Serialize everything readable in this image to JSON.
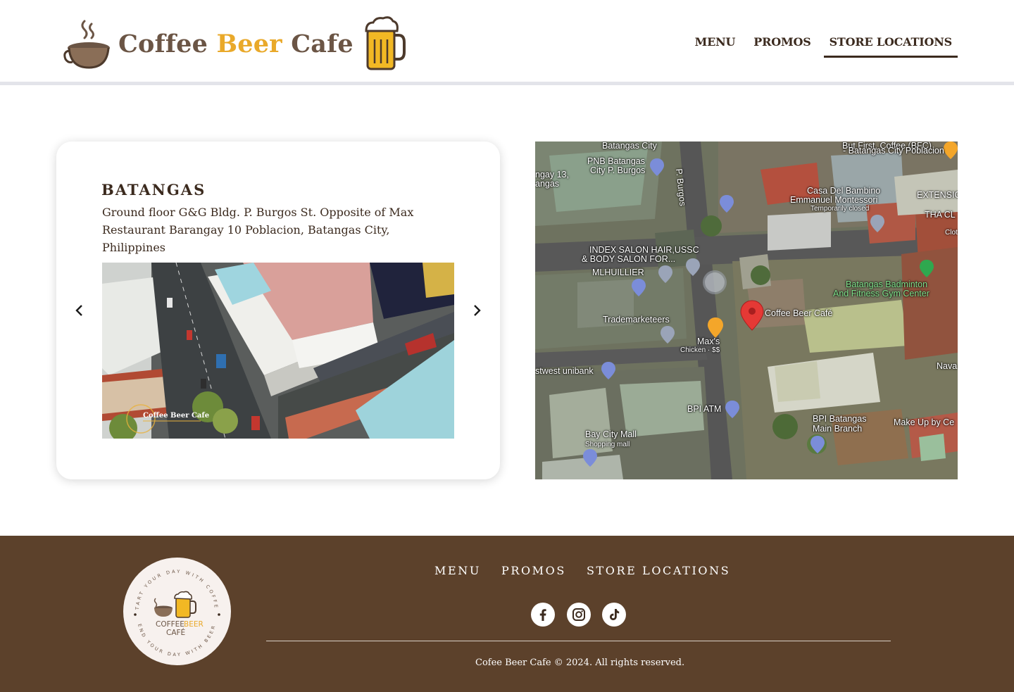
{
  "header": {
    "logo": {
      "word1": "Coffee",
      "word2": "Beer",
      "word3": "Cafe"
    },
    "nav": [
      {
        "label": "MENU",
        "active": false
      },
      {
        "label": "PROMOS",
        "active": false
      },
      {
        "label": "STORE LOCATIONS",
        "active": true
      }
    ]
  },
  "store": {
    "title": "BATANGAS",
    "address": "Ground floor G&G Bldg. P. Burgos St. Opposite of Max Restaurant Barangay 10 Poblacion, Batangas City, Philippines",
    "photo_watermark": "Coffee Beer Cafe",
    "prev_icon": "chevron-left-icon",
    "next_icon": "chevron-right-icon"
  },
  "map": {
    "labels": {
      "batangas_city": "Batangas City",
      "but_first": "But First, Coffee (BFC)",
      "but_first_2": "- Batangas City Poblacion",
      "pnb1": "PNB Batangas",
      "pnb2": "City P. Burgos",
      "burgos": "P. Burgos",
      "brgy13a": "ngay 13,",
      "brgy13b": "angas",
      "casa1": "Casa Del Bambino",
      "casa2": "Emmanuel Montessori",
      "casa3": "Temporarily closed",
      "extension": "EXTENSIC",
      "thai": "THA CL",
      "clot": "Clot",
      "index1": "INDEX SALON HAIR,USSC",
      "index2": "& BODY SALON FOR...",
      "mlhuillier": "MLHUILLIER",
      "badminton1": "Batangas Badminton",
      "badminton2": "And Fitness Gym Center",
      "coffee_beer": "Coffee Beer Café",
      "trademarketeers": "Trademarketeers",
      "maxs1": "Max's",
      "maxs2": "Chicken · $$",
      "eastwest": "stwest unibank",
      "nava": "Nava",
      "bpi_atm": "BPI ATM",
      "bpi1": "BPI Batangas",
      "bpi2": "Main Branch",
      "makeup": "Make Up by Ce",
      "baycity1": "Bay City Mall",
      "baycity2": "Shopping mall"
    }
  },
  "footer": {
    "badge": {
      "line1": "COFFEE",
      "line1b": "BEER",
      "line2": "CAFÉ",
      "ring_top": "START YOUR DAY WITH COFFEE",
      "ring_bottom": "END YOUR DAY WITH BEER"
    },
    "nav": [
      "MENU",
      "PROMOS",
      "STORE LOCATIONS"
    ],
    "socials": [
      "facebook-icon",
      "instagram-icon",
      "tiktok-icon"
    ],
    "copyright": "Cofee Beer Cafe  © 2024. All rights reserved."
  },
  "colors": {
    "brown_dark": "#3b2a1e",
    "footer_brown": "#5c412b",
    "logo_gold": "#e9a92a"
  }
}
